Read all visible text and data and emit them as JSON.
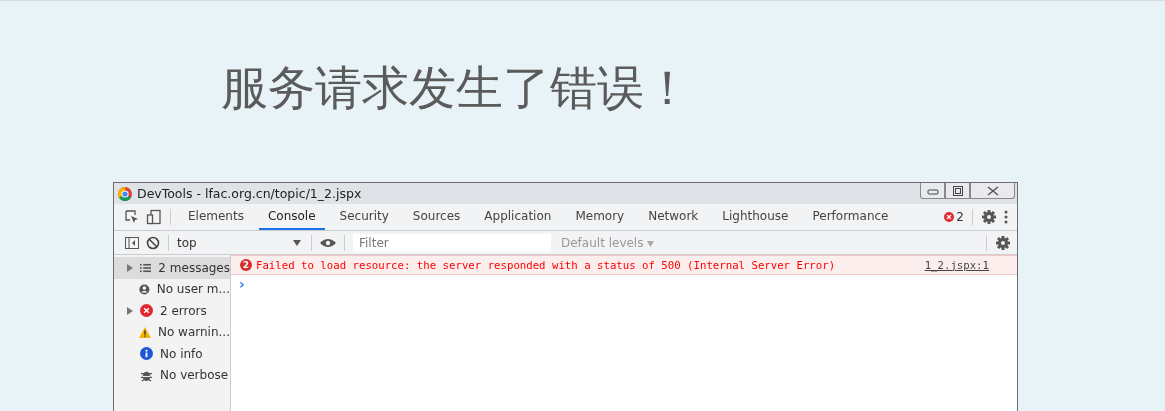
{
  "heading": "服务请求发生了错误！",
  "devtools": {
    "title": "DevTools - lfac.org.cn/topic/1_2.jspx",
    "tabs": [
      {
        "label": "Elements",
        "selected": false
      },
      {
        "label": "Console",
        "selected": true
      },
      {
        "label": "Security",
        "selected": false
      },
      {
        "label": "Sources",
        "selected": false
      },
      {
        "label": "Application",
        "selected": false
      },
      {
        "label": "Memory",
        "selected": false
      },
      {
        "label": "Network",
        "selected": false
      },
      {
        "label": "Lighthouse",
        "selected": false
      },
      {
        "label": "Performance",
        "selected": false
      }
    ],
    "error_count": "2",
    "context": "top",
    "filter": {
      "placeholder": "Filter"
    },
    "levels": "Default levels",
    "sidebar": [
      {
        "kind": "messages",
        "label": "2 messages",
        "expandable": true,
        "selected": true
      },
      {
        "kind": "user",
        "label": "No user m...",
        "expandable": false,
        "selected": false
      },
      {
        "kind": "errors",
        "label": "2 errors",
        "expandable": true,
        "selected": false
      },
      {
        "kind": "warnings",
        "label": "No warnin...",
        "expandable": false,
        "selected": false
      },
      {
        "kind": "info",
        "label": "No info",
        "expandable": false,
        "selected": false
      },
      {
        "kind": "verbose",
        "label": "No verbose",
        "expandable": false,
        "selected": false
      }
    ],
    "messages": [
      {
        "count": "2",
        "text": "Failed to load resource: the server responded with a status of 500 (Internal Server Error)",
        "source": "1_2.jspx:1"
      }
    ],
    "prompt": "›"
  }
}
